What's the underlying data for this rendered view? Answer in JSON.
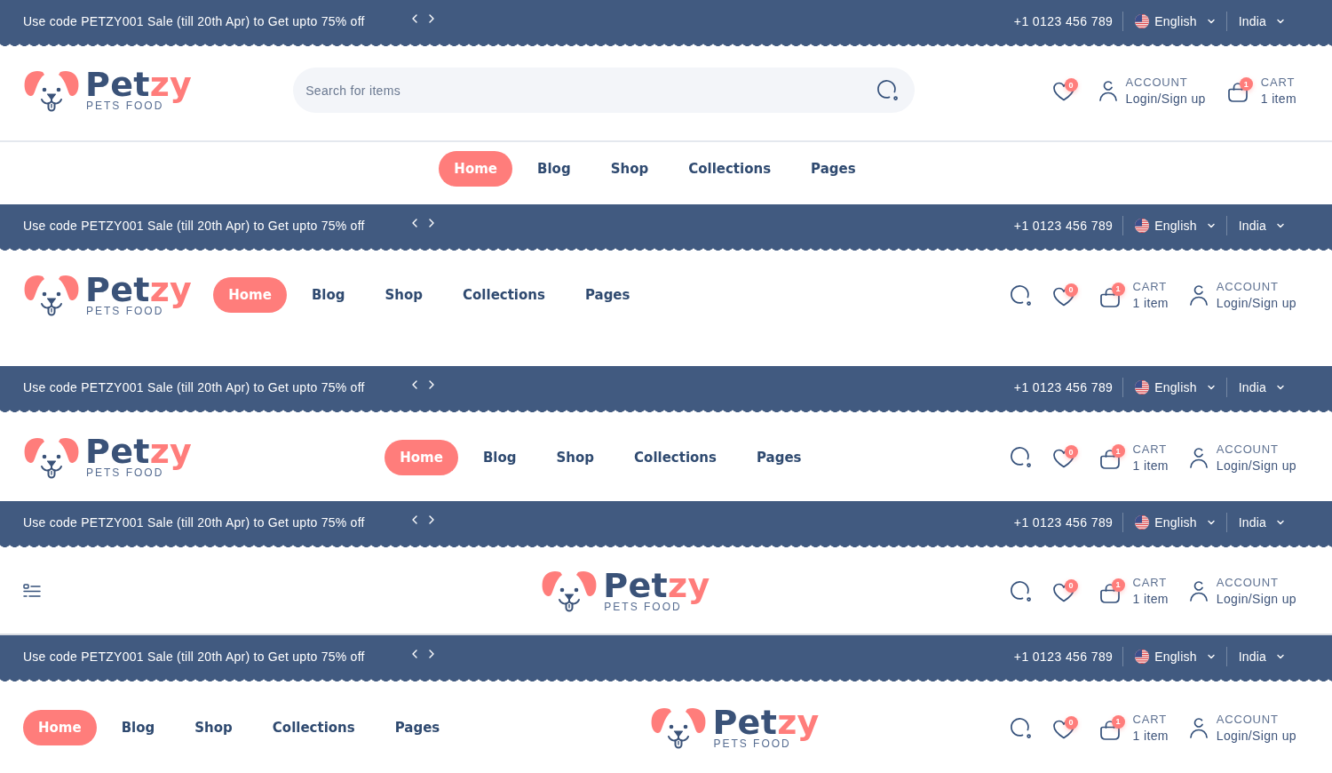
{
  "headers": [
    {
      "kind": "search_bar",
      "topbar": {
        "promo": "Use code PETZY001 Sale (till 20th Apr) to Get upto 75% off",
        "phone": "+1 0123 456 789",
        "language": "English",
        "region": "India"
      },
      "logo": {
        "name": "Pet",
        "name_accent": "zy",
        "tagline": "PETS FOOD"
      },
      "search": {
        "placeholder": "Search for items"
      },
      "actions": [
        {
          "kind": "wishlist",
          "count": "0"
        },
        {
          "kind": "account",
          "label": "ACCOUNT",
          "value": "Login/Sign up"
        },
        {
          "kind": "cart",
          "count": "1",
          "label": "CART",
          "value": "1 item"
        }
      ],
      "nav": [
        {
          "label": "Home",
          "selected": true
        },
        {
          "label": "Blog",
          "selected": false
        },
        {
          "label": "Shop",
          "selected": false
        },
        {
          "label": "Collections",
          "selected": false
        },
        {
          "label": "Pages",
          "selected": false
        }
      ]
    },
    {
      "kind": "logo_nav",
      "topbar": {
        "promo": "Use code PETZY001 Sale (till 20th Apr) to Get upto 75% off",
        "phone": "+1 0123 456 789",
        "language": "English",
        "region": "India"
      },
      "logo": {
        "name": "Pet",
        "name_accent": "zy",
        "tagline": "PETS FOOD"
      },
      "nav": [
        {
          "label": "Home",
          "selected": true
        },
        {
          "label": "Blog",
          "selected": false
        },
        {
          "label": "Shop",
          "selected": false
        },
        {
          "label": "Collections",
          "selected": false
        },
        {
          "label": "Pages",
          "selected": false
        }
      ],
      "actions": [
        {
          "kind": "search"
        },
        {
          "kind": "wishlist",
          "count": "0"
        },
        {
          "kind": "cart",
          "count": "1",
          "label": "CART",
          "value": "1 item"
        },
        {
          "kind": "account",
          "label": "ACCOUNT",
          "value": "Login/Sign up"
        }
      ]
    },
    {
      "kind": "centered_nav",
      "topbar": {
        "promo": "Use code PETZY001 Sale (till 20th Apr) to Get upto 75% off",
        "phone": "+1 0123 456 789",
        "language": "English",
        "region": "India"
      },
      "logo": {
        "name": "Pet",
        "name_accent": "zy",
        "tagline": "PETS FOOD"
      },
      "nav": [
        {
          "label": "Home",
          "selected": true
        },
        {
          "label": "Blog",
          "selected": false
        },
        {
          "label": "Shop",
          "selected": false
        },
        {
          "label": "Collections",
          "selected": false
        },
        {
          "label": "Pages",
          "selected": false
        }
      ],
      "actions": [
        {
          "kind": "search"
        },
        {
          "kind": "wishlist",
          "count": "0"
        },
        {
          "kind": "cart",
          "count": "1",
          "label": "CART",
          "value": "1 item"
        },
        {
          "kind": "account",
          "label": "ACCOUNT",
          "value": "Login/Sign up"
        }
      ]
    },
    {
      "kind": "menu_logo",
      "topbar": {
        "promo": "Use code PETZY001 Sale (till 20th Apr) to Get upto 75% off",
        "phone": "+1 0123 456 789",
        "language": "English",
        "region": "India"
      },
      "logo": {
        "name": "Pet",
        "name_accent": "zy",
        "tagline": "PETS FOOD"
      },
      "actions": [
        {
          "kind": "search"
        },
        {
          "kind": "wishlist",
          "count": "0"
        },
        {
          "kind": "cart",
          "count": "1",
          "label": "CART",
          "value": "1 item"
        },
        {
          "kind": "account",
          "label": "ACCOUNT",
          "value": "Login/Sign up"
        }
      ]
    },
    {
      "kind": "nav_logo",
      "topbar": {
        "promo": "Use code PETZY001 Sale (till 20th Apr) to Get upto 75% off",
        "phone": "+1 0123 456 789",
        "language": "English",
        "region": "India"
      },
      "nav": [
        {
          "label": "Home",
          "selected": true
        },
        {
          "label": "Blog",
          "selected": false
        },
        {
          "label": "Shop",
          "selected": false
        },
        {
          "label": "Collections",
          "selected": false
        },
        {
          "label": "Pages",
          "selected": false
        }
      ],
      "logo": {
        "name": "Pet",
        "name_accent": "zy",
        "tagline": "PETS FOOD"
      },
      "actions": [
        {
          "kind": "search"
        },
        {
          "kind": "wishlist",
          "count": "0"
        },
        {
          "kind": "cart",
          "count": "1",
          "label": "CART",
          "value": "1 item"
        },
        {
          "kind": "account",
          "label": "ACCOUNT",
          "value": "Login/Sign up"
        }
      ]
    }
  ]
}
